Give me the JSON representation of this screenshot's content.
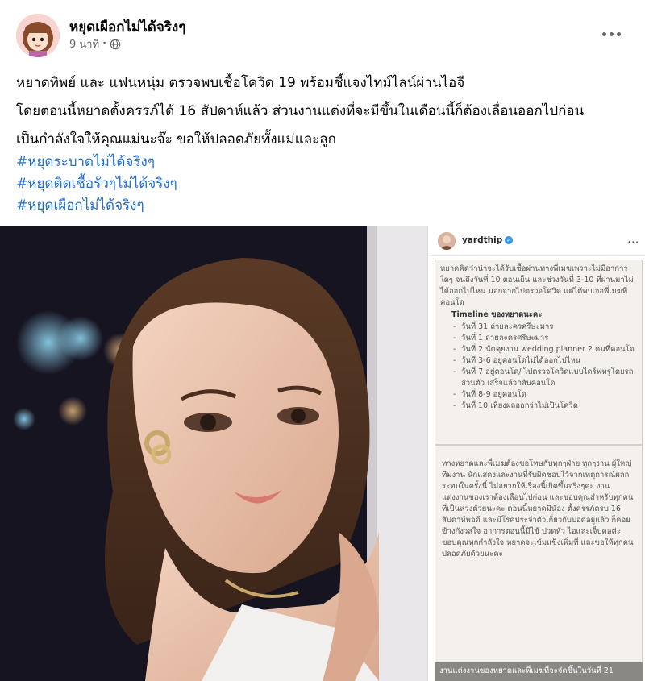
{
  "post": {
    "author": "หยุดเผือกไม่ได้จริงๆ",
    "time": "9 นาที",
    "separator": "·",
    "privacy_icon": "globe-icon",
    "more_icon": "more-horizontal-icon",
    "text_lines": [
      "หยาดทิพย์ และ แฟนหนุ่ม ตรวจพบเชื้อโควิด 19 พร้อมชี้แจงไทม์ไลน์ผ่านไอจี",
      "โดยตอนนี้หยาดตั้งครรภ์ได้ 16 สัปดาห์แล้ว ส่วนงานแต่งที่จะมีขึ้นในเดือนนี้ก็ต้องเลื่อนออกไปก่อน",
      "เป็นกำลังใจให้คุณแม่นะจ๊ะ ขอให้ปลอดภัยทั้งแม่และลูก"
    ],
    "hashtags": [
      "#หยุดระบาดไม่ได้จริงๆ",
      "#หยุดติดเชื้อรัวๆไม่ได้จริงๆ",
      "#หยุดเผือกไม่ได้จริงๆ"
    ]
  },
  "instagram": {
    "username": "yardthip",
    "verified_icon": "verified-badge-icon",
    "more": "...",
    "note1_intro": "หยาดคิดว่าน่าจะได้รับเชื้อผ่านทางพี่เมฆเพราะไม่มีอาการใดๆ จนถึงวันที่ 10 ตอนเย็น และช่วงวันที่ 3-10 ที่ผ่านมาไม่ได้ออกไปไหน นอกจากไปตรวจโควิด แต่ได้พบเจอพี่เมฆที่คอนโด",
    "timeline_title": "Timeline ของหยาดนะคะ",
    "timeline": [
      "วันที่ 31 ถ่ายละครศรีษะมาร",
      "วันที่ 1 ถ่ายละครศรีษะมาร",
      "วันที่ 2 นัดคุยงาน wedding planner 2 คนที่คอนโด",
      "วันที่ 3-6 อยู่คอนโดไม่ได้ออกไปไหน",
      "วันที่ 7 อยู่คอนโด/ ไปตรวจโควิดแบบไดร์ฟทรูโดยรถส่วนตัว เสร็จแล้วกลับคอนโด",
      "วันที่ 8-9 อยู่คอนโด",
      "วันที่ 10 เที่ยงผลออกว่าไม่เป็นโควิด"
    ],
    "note2_text": "ทางหยาดและพี่เมฆต้องขอโทษกับทุกๆฝ่าย ทุกๆงาน ผู้ใหญ่ ทีมงาน นักแสดงและงานที่รับผิดชอบไว้จากเหตุการณ์ผลกระทบในครั้งนี้ ไม่อยากให้เรื่องนี้เกิดขึ้นจริงๆค่ะ งานแต่งงานของเราต้องเลื่อนไปก่อน และขอบคุณสำหรับทุกคนที่เป็นห่วงตัวยนะคะ ตอนนี้หยาดมีน้อง ตั้งครรภ์ครบ 16 สัปดาห์พอดี และมีโรคประจำตัวเกี่ยวกับปอดอยู่แล้ว ก็ค่อยข้างกังวลใจ อาการตอนนี้มีไข้ ปวดหัว ไอและเจ็บคอค่ะ ขอบคุณทุกกำลังใจ หยาดจะเข้มแข็งเพิ่มที่ และขอให้ทุกคนปลอดภัยด้วยนะคะ",
    "note3_text": "งานแต่งงานของหยาดและพี่เมฆที่จะจัดขึ้นในวันที่ 21"
  },
  "colors": {
    "link": "#216fdb",
    "meta": "#65676b",
    "text": "#050505"
  }
}
